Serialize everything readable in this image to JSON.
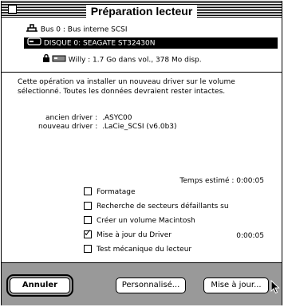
{
  "window": {
    "title": "Préparation lecteur"
  },
  "devices": {
    "bus_label": "Bus 0 : Bus interne SCSI",
    "disk_label": "DISQUE 0:  SEAGATE ST32430N",
    "volume_label": "Willy : 1.7 Go dans vol., 378 Mo disp."
  },
  "description": "Cette opération va installer un nouveau driver sur le volume sélectionné. Toutes les données devraient rester intactes.",
  "driver": {
    "old_label": "ancien  driver :",
    "old_value": ".ASYC00",
    "new_label": "nouveau driver :",
    "new_value": ".LaCie_SCSI (v6.0b3)"
  },
  "time_estimate": {
    "label": "Temps estimé :",
    "value": "0:00:05"
  },
  "options": [
    {
      "label": "Formatage",
      "checked": false
    },
    {
      "label": "Recherche de secteurs défaillants su",
      "checked": false
    },
    {
      "label": "Créer un volume Macintosh",
      "checked": false
    },
    {
      "label": "Mise à jour du Driver",
      "checked": true,
      "time": "0:00:05"
    },
    {
      "label": "Test mécanique du lecteur",
      "checked": false
    }
  ],
  "buttons": {
    "cancel": "Annuler",
    "customize": "Personnalisé...",
    "update": "Mise à jour..."
  }
}
